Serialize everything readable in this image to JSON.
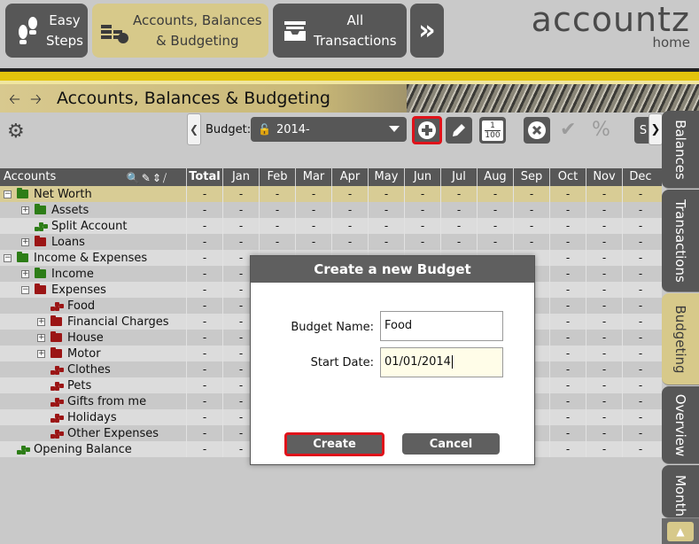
{
  "nav": {
    "easy_steps": "Easy\nSteps",
    "easy_l1": "Easy",
    "easy_l2": "Steps",
    "acc_l1": "Accounts, Balances",
    "acc_l2": "& Budgeting",
    "all_l1": "All",
    "all_l2": "Transactions",
    "more": "»"
  },
  "brand": {
    "logo": "accountz",
    "sub": "home"
  },
  "page_title": "Accounts, Balances & Budgeting",
  "toolbar": {
    "budget_label": "Budget:",
    "budget_value": "2014-",
    "frac_top": "1",
    "frac_bottom": "100",
    "pct": "%",
    "s_label": "S"
  },
  "side_tabs": [
    "Balances",
    "Transactions",
    "Budgeting",
    "Overview",
    "Monthly"
  ],
  "grid": {
    "accounts_header": "Accounts",
    "columns": [
      "Total",
      "Jan",
      "Feb",
      "Mar",
      "Apr",
      "May",
      "Jun",
      "Jul",
      "Aug",
      "Sep",
      "Oct",
      "Nov",
      "Dec"
    ],
    "rows": [
      {
        "name": "Net Worth",
        "level": 0,
        "expander": "−",
        "icon": "folder",
        "color": "green",
        "selected": true
      },
      {
        "name": "Assets",
        "level": 1,
        "expander": "+",
        "icon": "folder",
        "color": "green"
      },
      {
        "name": "Split Account",
        "level": 1,
        "expander": "",
        "icon": "coins",
        "color": "green"
      },
      {
        "name": "Loans",
        "level": 1,
        "expander": "+",
        "icon": "folder",
        "color": "red"
      },
      {
        "name": "Income & Expenses",
        "level": 0,
        "expander": "−",
        "icon": "folder",
        "color": "green"
      },
      {
        "name": "Income",
        "level": 1,
        "expander": "+",
        "icon": "folder",
        "color": "green"
      },
      {
        "name": "Expenses",
        "level": 1,
        "expander": "−",
        "icon": "folder",
        "color": "red"
      },
      {
        "name": "Food",
        "level": 2,
        "expander": "",
        "icon": "coins",
        "color": "red"
      },
      {
        "name": "Financial Charges",
        "level": 2,
        "expander": "+",
        "icon": "folder",
        "color": "red"
      },
      {
        "name": "House",
        "level": 2,
        "expander": "+",
        "icon": "folder",
        "color": "red"
      },
      {
        "name": "Motor",
        "level": 2,
        "expander": "+",
        "icon": "folder",
        "color": "red"
      },
      {
        "name": "Clothes",
        "level": 2,
        "expander": "",
        "icon": "coins",
        "color": "red"
      },
      {
        "name": "Pets",
        "level": 2,
        "expander": "",
        "icon": "coins",
        "color": "red"
      },
      {
        "name": "Gifts from me",
        "level": 2,
        "expander": "",
        "icon": "coins",
        "color": "red"
      },
      {
        "name": "Holidays",
        "level": 2,
        "expander": "",
        "icon": "coins",
        "color": "red"
      },
      {
        "name": "Other Expenses",
        "level": 2,
        "expander": "",
        "icon": "coins",
        "color": "red"
      },
      {
        "name": "Opening Balance",
        "level": 0,
        "expander": "",
        "icon": "coins",
        "color": "green"
      }
    ],
    "cell_value": "-"
  },
  "dialog": {
    "title": "Create a new Budget",
    "name_label": "Budget Name:",
    "name_value": "Food",
    "date_label": "Start Date:",
    "date_value": "01/01/2014",
    "create_label": "Create",
    "cancel_label": "Cancel"
  },
  "colors": {
    "accent": "#d7c98a",
    "highlight": "#e0121a",
    "dark": "#575757",
    "stripe": "#e3c30c"
  }
}
